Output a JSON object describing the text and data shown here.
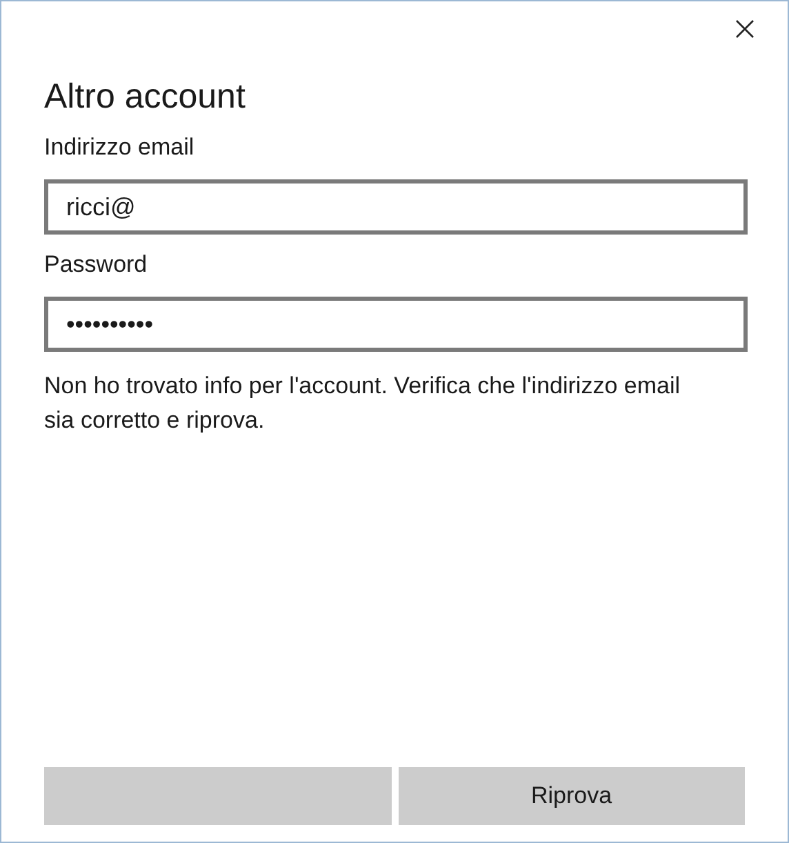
{
  "title": "Altro account",
  "fields": [
    {
      "label": "Indirizzo email",
      "value": "ricci@"
    },
    {
      "label": "Password",
      "value": "••••••••••"
    }
  ],
  "message": "Non ho trovato info per l'account. Verifica che l'indirizzo email sia corretto e riprova.",
  "buttons": [
    {
      "label": "Riprova"
    }
  ]
}
